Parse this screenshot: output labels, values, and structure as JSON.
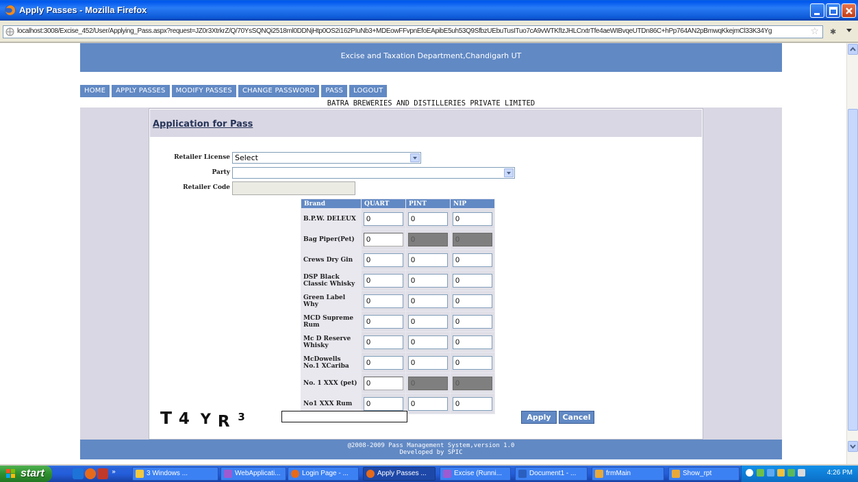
{
  "window": {
    "title": "Apply Passes - Mozilla Firefox"
  },
  "browser": {
    "url": "localhost:3008/Excise_452/User/Applying_Pass.aspx?request=JZ0r3XtrkrZ/Q/70YsSQNQi2518ml0DDNjHtp0OS2i162PIuNb3+MDEowFFvpnEfoEApibE5uh53Q9SfbzUEbuTusITuo7cA9vWTKfIzJHLCrxtrTfe4aeWIBvqeUTDn86C+hPp764AN2pBmwqKkejmCl33K34Yg"
  },
  "header": {
    "department": "Excise and Taxation Department,Chandigarh UT"
  },
  "menu": [
    "HOME",
    "APPLY PASSES",
    "MODIFY PASSES",
    "CHANGE PASSWORD",
    "PASS",
    "LOGOUT"
  ],
  "company": "BATRA BREWERIES AND DISTILLERIES PRIVATE LIMITED",
  "form": {
    "title": "Application for Pass",
    "retailer_license_label": "Retailer License",
    "retailer_license_value": "Select",
    "party_label": "Party",
    "party_value": "",
    "retailer_code_label": "Retailer Code",
    "retailer_code_value": ""
  },
  "table": {
    "headers": [
      "Brand",
      "QUART",
      "PINT",
      "NIP"
    ],
    "rows": [
      {
        "brand": "B.P.W. DELEUX",
        "quart": "0",
        "pint": "0",
        "nip": "0",
        "pint_disabled": false,
        "nip_disabled": false
      },
      {
        "brand": "Bag Piper(Pet)",
        "quart": "0",
        "pint": "0",
        "nip": "0",
        "pint_disabled": true,
        "nip_disabled": true
      },
      {
        "brand": "Crews Dry Gin",
        "quart": "0",
        "pint": "0",
        "nip": "0",
        "pint_disabled": false,
        "nip_disabled": false
      },
      {
        "brand": "DSP Black Classic Whisky",
        "quart": "0",
        "pint": "0",
        "nip": "0",
        "pint_disabled": false,
        "nip_disabled": false
      },
      {
        "brand": "Green Label Why",
        "quart": "0",
        "pint": "0",
        "nip": "0",
        "pint_disabled": false,
        "nip_disabled": false
      },
      {
        "brand": "MCD Supreme Rum",
        "quart": "0",
        "pint": "0",
        "nip": "0",
        "pint_disabled": false,
        "nip_disabled": false
      },
      {
        "brand": "Mc D Reserve Whisky",
        "quart": "0",
        "pint": "0",
        "nip": "0",
        "pint_disabled": false,
        "nip_disabled": false
      },
      {
        "brand": "McDowells No.1 XCariba",
        "quart": "0",
        "pint": "0",
        "nip": "0",
        "pint_disabled": false,
        "nip_disabled": false
      },
      {
        "brand": "No. 1 XXX (pet)",
        "quart": "0",
        "pint": "0",
        "nip": "0",
        "pint_disabled": true,
        "nip_disabled": true
      },
      {
        "brand": "No1 XXX Rum",
        "quart": "0",
        "pint": "0",
        "nip": "0",
        "pint_disabled": false,
        "nip_disabled": false
      }
    ]
  },
  "captcha": {
    "chars": [
      "T",
      "4",
      "Y",
      "R",
      "3"
    ],
    "input_value": ""
  },
  "buttons": {
    "apply": "Apply",
    "cancel": "Cancel"
  },
  "footer": {
    "line1": "@2008-2009 Pass Management System,version 1.0",
    "line2": "Developed by SPIC"
  },
  "taskbar": {
    "start": "start",
    "tasks": [
      "3 Windows ...",
      "WebApplicati...",
      "Login Page - ...",
      "Apply Passes ...",
      "Excise (Runni...",
      "Document1 - ...",
      "frmMain",
      "Show_rpt"
    ],
    "active_task": "Apply Passes ...",
    "clock": "4:26 PM"
  },
  "colors": {
    "theme_blue": "#6189c4",
    "band_grey": "#d9d7e3",
    "disabled_input": "#7f7f7f"
  }
}
